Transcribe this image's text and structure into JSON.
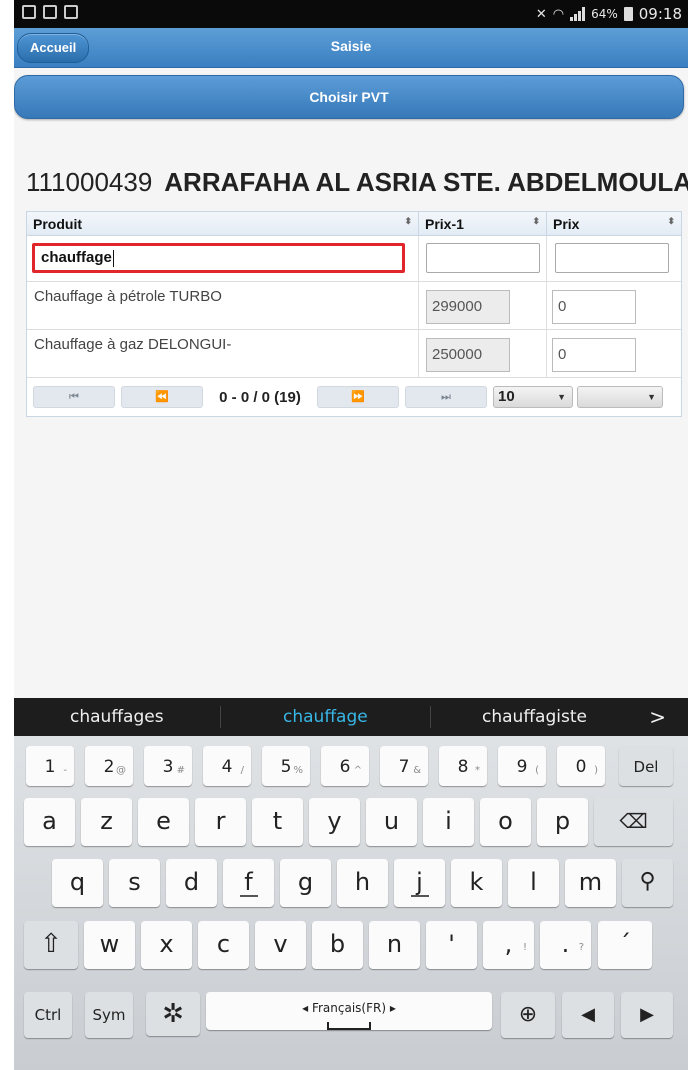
{
  "status_bar": {
    "battery": "64%",
    "time": "09:18"
  },
  "header": {
    "home_button": "Accueil",
    "title": "Saisie"
  },
  "choose_pvt_button": "Choisir PVT",
  "client": {
    "code": "111000439",
    "name": "ARRAFAHA AL ASRIA STE. ABDELMOULA"
  },
  "grid": {
    "columns": [
      "Produit",
      "Prix-1",
      "Prix"
    ],
    "sort_icon": "⬍",
    "filter_value": "chauffage",
    "rows": [
      {
        "product": "Chauffage à pétrole TURBO",
        "prix1": "299000",
        "prix": "0"
      },
      {
        "product": "Chauffage à gaz DELONGUI-",
        "prix1": "250000",
        "prix": "0"
      }
    ],
    "pager": {
      "info": "0 - 0 / 0 (19)",
      "page_size": "10",
      "first": "⏮",
      "prev": "⏪",
      "next": "⏩",
      "last": "⏭"
    }
  },
  "keyboard": {
    "suggestions": [
      "chauffages",
      "chauffage",
      "chauffagiste"
    ],
    "suggestion_more": ">",
    "number_row": [
      {
        "k": "1",
        "s": "-"
      },
      {
        "k": "2",
        "s": "@"
      },
      {
        "k": "3",
        "s": "#"
      },
      {
        "k": "4",
        "s": "/"
      },
      {
        "k": "5",
        "s": "%"
      },
      {
        "k": "6",
        "s": "^"
      },
      {
        "k": "7",
        "s": "&"
      },
      {
        "k": "8",
        "s": "*"
      },
      {
        "k": "9",
        "s": "("
      },
      {
        "k": "0",
        "s": ")"
      }
    ],
    "del": "Del",
    "row1": [
      "a",
      "z",
      "e",
      "r",
      "t",
      "y",
      "u",
      "i",
      "o",
      "p"
    ],
    "row2": [
      "q",
      "s",
      "d",
      "f",
      "g",
      "h",
      "j",
      "k",
      "l",
      "m"
    ],
    "row3": [
      "w",
      "x",
      "c",
      "v",
      "b",
      "n",
      "'",
      ",",
      "."
    ],
    "row3_sup": [
      "",
      "",
      "",
      "",
      "",
      "",
      "",
      "!",
      "?"
    ],
    "accent_key": "´",
    "ctrl": "Ctrl",
    "sym": "Sym",
    "language": "◂ Français(FR) ▸"
  }
}
